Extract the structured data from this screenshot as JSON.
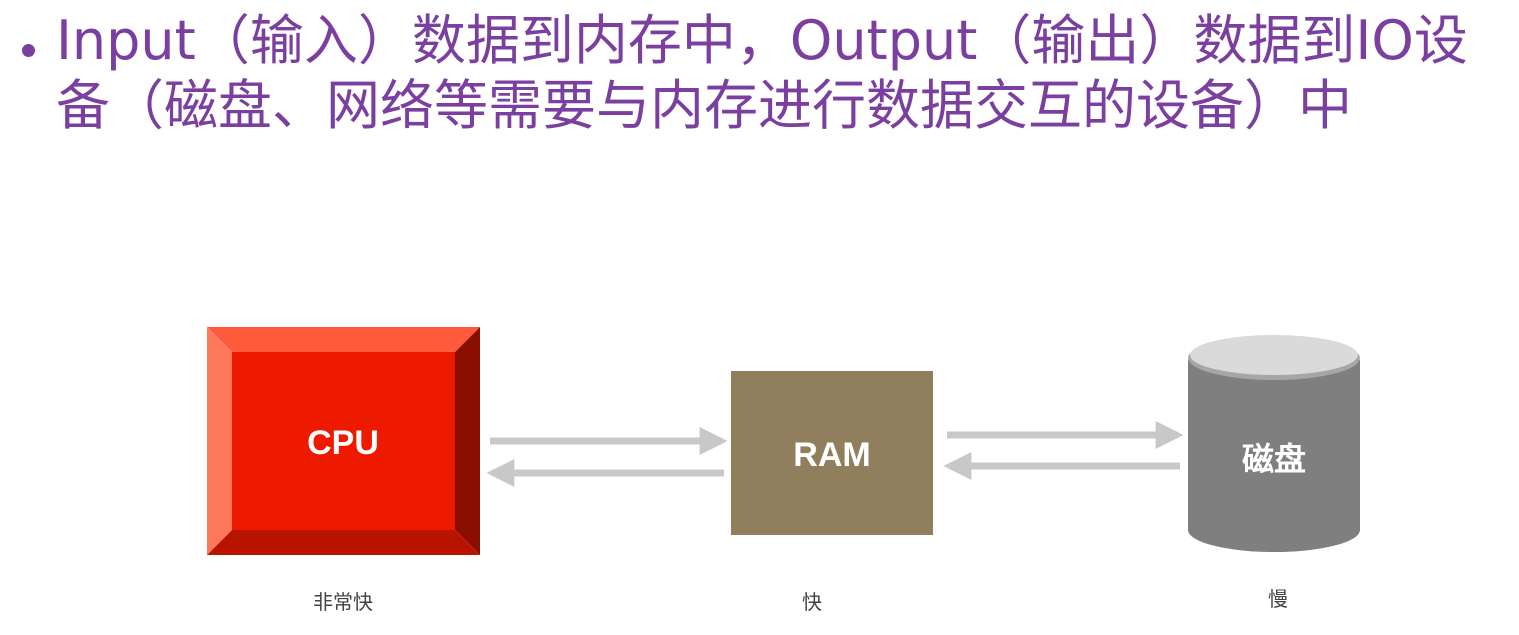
{
  "slide": {
    "bullet_text": "Input（输入）数据到内存中，Output（输出）数据到IO设备（磁盘、网络等需要与内存进行数据交互的设备）中"
  },
  "diagram": {
    "nodes": [
      {
        "id": "cpu",
        "label": "CPU",
        "caption": "非常快",
        "color": "#ee1a00"
      },
      {
        "id": "ram",
        "label": "RAM",
        "caption": "快",
        "color": "#8f7f5c"
      },
      {
        "id": "disk",
        "label": "磁盘",
        "caption": "慢",
        "color": "#7f7f7f"
      }
    ],
    "arrow_color": "#c8c8c8"
  }
}
